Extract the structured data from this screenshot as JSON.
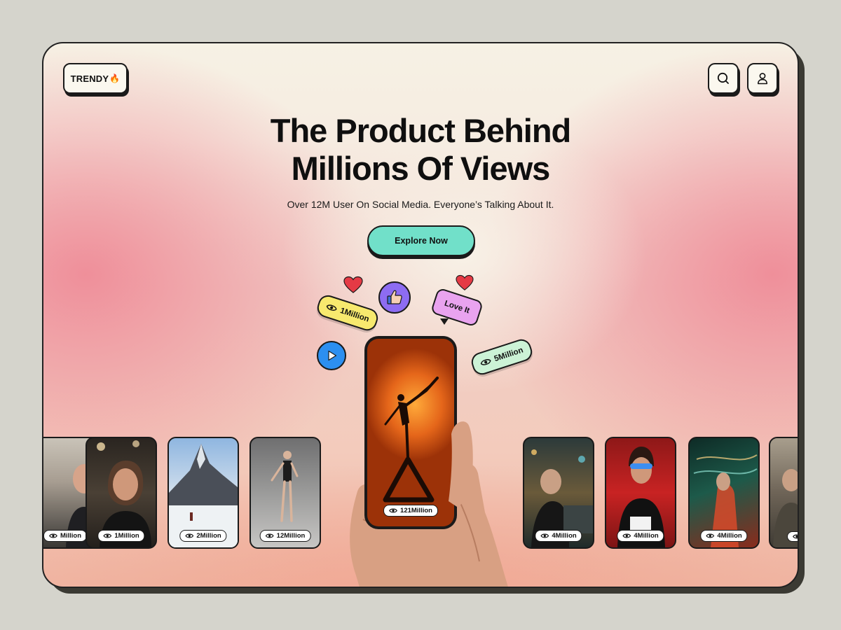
{
  "brand": {
    "name": "TRENDY",
    "emoji": "🔥"
  },
  "header": {
    "search_icon": "search-icon",
    "user_icon": "user-icon"
  },
  "hero": {
    "title_line1": "The Product Behind",
    "title_line2": "Millions Of Views",
    "subtitle": "Over 12M User On Social Media. Everyone’s Talking About It.",
    "cta_label": "Explore Now"
  },
  "stickers": {
    "views_left": "1Million",
    "views_right": "5Million",
    "love_label": "Love It"
  },
  "phone": {
    "views": "121Million"
  },
  "cards": [
    {
      "views": "Million"
    },
    {
      "views": "1Million"
    },
    {
      "views": "2Million"
    },
    {
      "views": "12Million"
    },
    {
      "views": "4Million"
    },
    {
      "views": "4Million"
    },
    {
      "views": "4Million"
    },
    {
      "views": ""
    }
  ],
  "colors": {
    "cta": "#71e0c9",
    "pill_yellow": "#f7e96e",
    "pill_green": "#ccf2d6",
    "love_bubble": "#e9a3ef",
    "thumbs_circle": "#8d6cf2",
    "play_circle": "#2c8ff0",
    "heart": "#e53a45"
  }
}
